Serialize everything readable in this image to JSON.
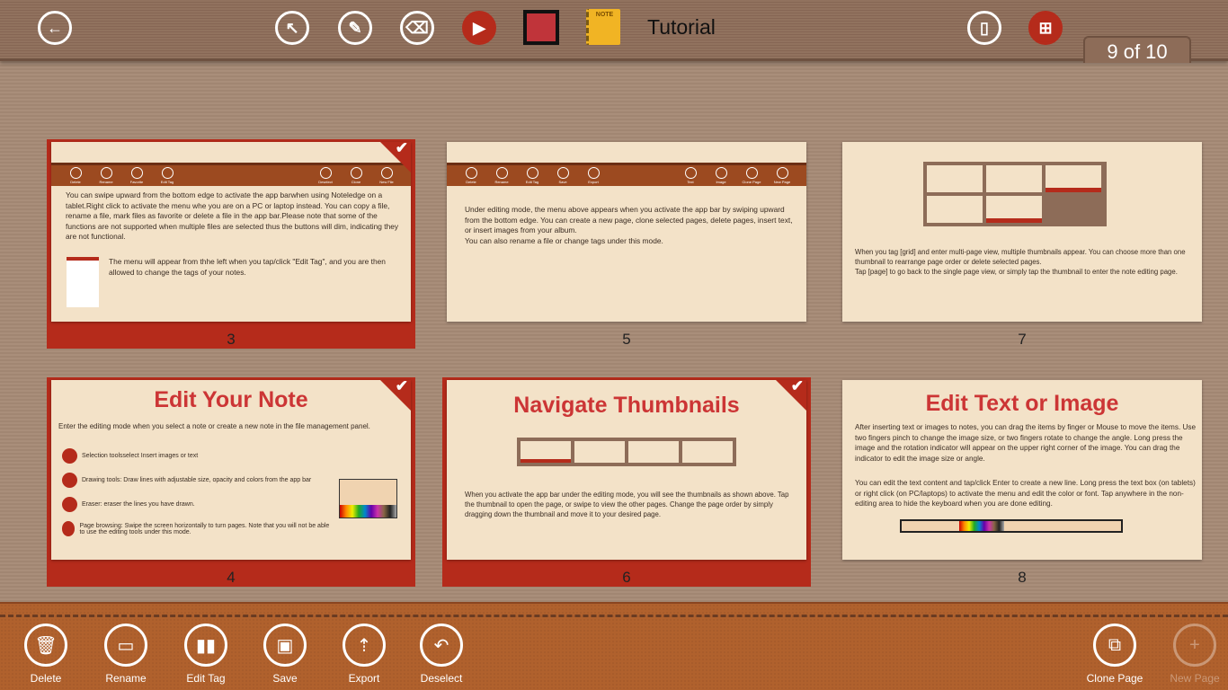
{
  "topbar": {
    "title": "Tutorial",
    "page_indicator": "9 of 10",
    "icons": [
      "back-arrow-icon",
      "selection-arrow-icon",
      "pen-icon",
      "eraser-icon",
      "page-browse-icon",
      "color-swatch",
      "notebook-cover-icon",
      "single-page-view-icon",
      "multi-page-view-icon"
    ],
    "notebook_label": "NOTE",
    "color_swatch": "#c0343a",
    "accent": "#b52b1b"
  },
  "pages": [
    {
      "number": "3",
      "selected": true,
      "appbar_items": [
        "Delete",
        "Rename",
        "Favorite",
        "Edit Tag",
        "Deselect",
        "Clone",
        "New File"
      ],
      "text": "You can swipe upward from the bottom edge to activate the app barwhen using Noteledge on a tablet.Right click to activate the menu whe you are on a PC or laptop instead. You can copy a file, rename a file, mark files as favorite or delete a file in the app bar.Please note that some of the functions are not supported when multiple files are selected thus the buttons will dim, indicating they are not functional.",
      "text2": "The menu will appear from thhe left when you tap/click \"Edit Tag\", and you are then allowed to change the tags of your notes."
    },
    {
      "number": "5",
      "selected": false,
      "appbar_items": [
        "Delete",
        "Rename",
        "Edit Tag",
        "Save",
        "Export",
        "Text",
        "Image",
        "Clone Page",
        "New Page"
      ],
      "text": "Under editing mode, the menu above appears when you activate the app bar by swiping upward from the bottom edge. You can create a new page, clone selected pages, delete pages, insert text, or insert images from your album.",
      "text2": "You can also rename a file or change tags under this mode."
    },
    {
      "number": "7",
      "selected": false,
      "text": "When you  tag [grid] and enter multi-page view, multiple thumbnails appear. You can choose more than one thumbnail to rearrange page order or delete selected pages.",
      "text2": "Tap [page] to go back to the single page view, or simply tap the thumbnail to enter the note editing page."
    },
    {
      "number": "4",
      "selected": true,
      "heading": "Edit Your Note",
      "text": "Enter the editing mode when you select a note or create a new note in   the file management panel.",
      "items": [
        "Selection toolsselect Insert images or text",
        "Drawing tools: Draw lines with adjustable size, opacity and colors from the app bar",
        "Eraser: eraser the lines you have drawn.",
        "Page browsing: Swipe the screen horizontally to turn pages. Note that you will not  be able to use the editing tools under this mode."
      ]
    },
    {
      "number": "6",
      "selected": true,
      "heading": "Navigate Thumbnails",
      "text": "When you activate the app bar under the editing mode, you will see the thumbnails as shown above. Tap the thumbnail to open the page, or swipe to view the other pages. Change the page order by simply dragging down the thumbnail and move it to your desired page."
    },
    {
      "number": "8",
      "selected": false,
      "heading": "Edit Text or Image",
      "text": "After inserting text or images to notes, you can drag the items by finger or Mouse to move the items. Use two fingers pinch to change the image size, or two fingers rotate to change the angle. Long press the image and the rotation indicator  will appear on the upper right corner of the image. You can drag the indicator to edit the image size or angle.",
      "text2": "You can edit the text content and tap/click Enter to create a new line. Long press the text box (on tablets) or right click (on PC/laptops) to activate the menu and edit the color or font. Tap anywhere in the non-editing area to hide the keyboard when you are done editing."
    }
  ],
  "bottombar": {
    "left": [
      {
        "label": "Delete",
        "icon": "trash-icon"
      },
      {
        "label": "Rename",
        "icon": "rename-icon"
      },
      {
        "label": "Edit Tag",
        "icon": "books-icon"
      },
      {
        "label": "Save",
        "icon": "floppy-icon"
      },
      {
        "label": "Export",
        "icon": "export-icon"
      },
      {
        "label": "Deselect",
        "icon": "deselect-icon"
      }
    ],
    "right": [
      {
        "label": "Clone Page",
        "icon": "clone-icon",
        "enabled": true
      },
      {
        "label": "New Page",
        "icon": "plus-icon",
        "enabled": false
      }
    ]
  }
}
